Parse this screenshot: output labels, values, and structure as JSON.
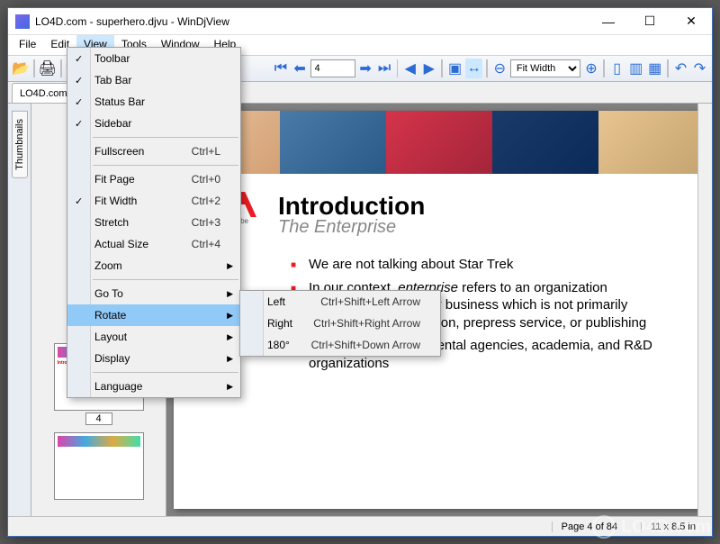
{
  "window": {
    "title": "LO4D.com - superhero.djvu - WinDjView"
  },
  "menubar": [
    "File",
    "Edit",
    "View",
    "Tools",
    "Window",
    "Help"
  ],
  "menubar_active": 2,
  "toolbar": {
    "page_input": "4",
    "zoom_select": "Fit Width"
  },
  "tab": {
    "label": "LO4D.com..."
  },
  "sidebar": {
    "tab": "Thumbnails"
  },
  "thumbs": [
    {
      "num": "4"
    }
  ],
  "view_menu": {
    "groups": [
      [
        {
          "label": "Toolbar",
          "checked": true
        },
        {
          "label": "Tab Bar",
          "checked": true
        },
        {
          "label": "Status Bar",
          "checked": true
        },
        {
          "label": "Sidebar",
          "checked": true
        }
      ],
      [
        {
          "label": "Fullscreen",
          "shortcut": "Ctrl+L"
        }
      ],
      [
        {
          "label": "Fit Page",
          "shortcut": "Ctrl+0"
        },
        {
          "label": "Fit Width",
          "shortcut": "Ctrl+2",
          "checked": true
        },
        {
          "label": "Stretch",
          "shortcut": "Ctrl+3"
        },
        {
          "label": "Actual Size",
          "shortcut": "Ctrl+4"
        },
        {
          "label": "Zoom",
          "submenu": true
        }
      ],
      [
        {
          "label": "Go To",
          "submenu": true
        },
        {
          "label": "Rotate",
          "submenu": true,
          "highlight": true
        },
        {
          "label": "Layout",
          "submenu": true
        },
        {
          "label": "Display",
          "submenu": true
        }
      ],
      [
        {
          "label": "Language",
          "submenu": true
        }
      ]
    ]
  },
  "rotate_submenu": [
    {
      "label": "Left",
      "shortcut": "Ctrl+Shift+Left Arrow"
    },
    {
      "label": "Right",
      "shortcut": "Ctrl+Shift+Right Arrow"
    },
    {
      "label": "180°",
      "shortcut": "Ctrl+Shift+Down Arrow"
    }
  ],
  "document": {
    "adobe_label": "Adobe",
    "title": "Introduction",
    "subtitle": "The Enterprise",
    "bullets": [
      "We are not talking about Star Trek",
      "In our context, enterprise refers to an organization conducting day-to-day business which is not primarily creative content creation, prepress service, or publishing",
      "May include governmental agencies, academia, and R&D organizations"
    ]
  },
  "status": {
    "page": "Page 4 of 84",
    "size": "11 x 8.5 in"
  },
  "watermark": "LO4D.com"
}
